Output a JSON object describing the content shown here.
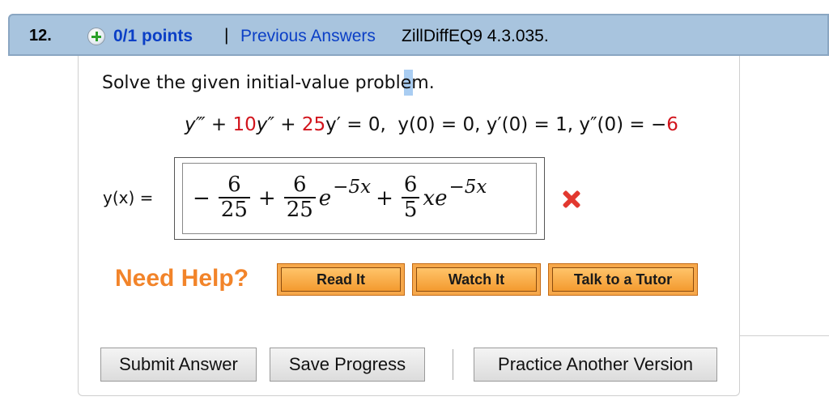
{
  "header": {
    "number": "12.",
    "points": "0/1 points",
    "separator": "|",
    "previous_answers": "Previous Answers",
    "source": "ZillDiffEQ9 4.3.035."
  },
  "question": {
    "prompt": "Solve the given initial-value problem.",
    "equation": {
      "part1": "y‴ + ",
      "coef1": "10",
      "part2": "y″ + ",
      "coef2": "25",
      "part3": "y′ = 0,  y(0) = 0, y′(0) = 1, y″(0) = −",
      "last": "6"
    },
    "answer_label": "y(x) =",
    "answer": {
      "t1_sign": "−",
      "t1_num": "6",
      "t1_den": "25",
      "op1": "+",
      "t2_num": "6",
      "t2_den": "25",
      "t2_base": "e",
      "t2_exp": "−5x",
      "op2": "+",
      "t3_num": "6",
      "t3_den": "5",
      "t3_base": "xe",
      "t3_exp": "−5x"
    },
    "result": "incorrect"
  },
  "help": {
    "label": "Need Help?",
    "read_it": "Read It",
    "watch_it": "Watch It",
    "talk_tutor": "Talk to a Tutor"
  },
  "actions": {
    "submit": "Submit Answer",
    "save": "Save Progress",
    "practice": "Practice Another Version"
  },
  "colors": {
    "header_bg": "#a8c4de",
    "link": "#0b3fc6",
    "accent_red": "#d2141c",
    "help_orange": "#f2842a"
  }
}
